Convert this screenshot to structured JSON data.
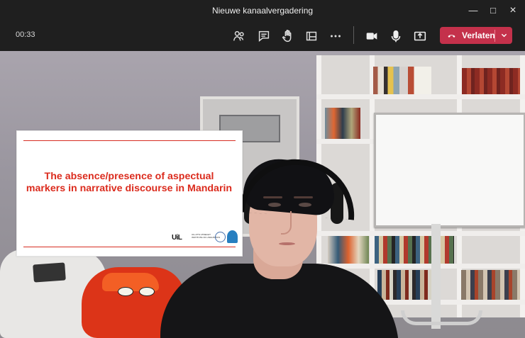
{
  "window": {
    "title": "Nieuwe kanaalvergadering",
    "controls": [
      "—",
      "□",
      "×"
    ]
  },
  "meeting_bar": {
    "elapsed_time": "00:33",
    "leave_button": {
      "label": "Verlaten",
      "color": "#c4314b"
    },
    "icons": [
      "participants-icon",
      "chat-icon",
      "raise-hand-icon",
      "rooms-icon",
      "more-options-icon",
      "camera-icon",
      "microphone-icon",
      "share-screen-icon",
      "phone-hangup-icon",
      "chevron-down-icon"
    ]
  },
  "presentation": {
    "title": "The absence/presence of aspectual markers in narrative discourse in Mandarin",
    "logo_text": "UiL",
    "logo_subtext": "UIL-OTS UTRECHT INSTITUTE OF LINGUISTICS"
  },
  "colors": {
    "app_background": "#1f1f1f",
    "slide_accent": "#d72d22",
    "leave_red": "#c4314b"
  }
}
